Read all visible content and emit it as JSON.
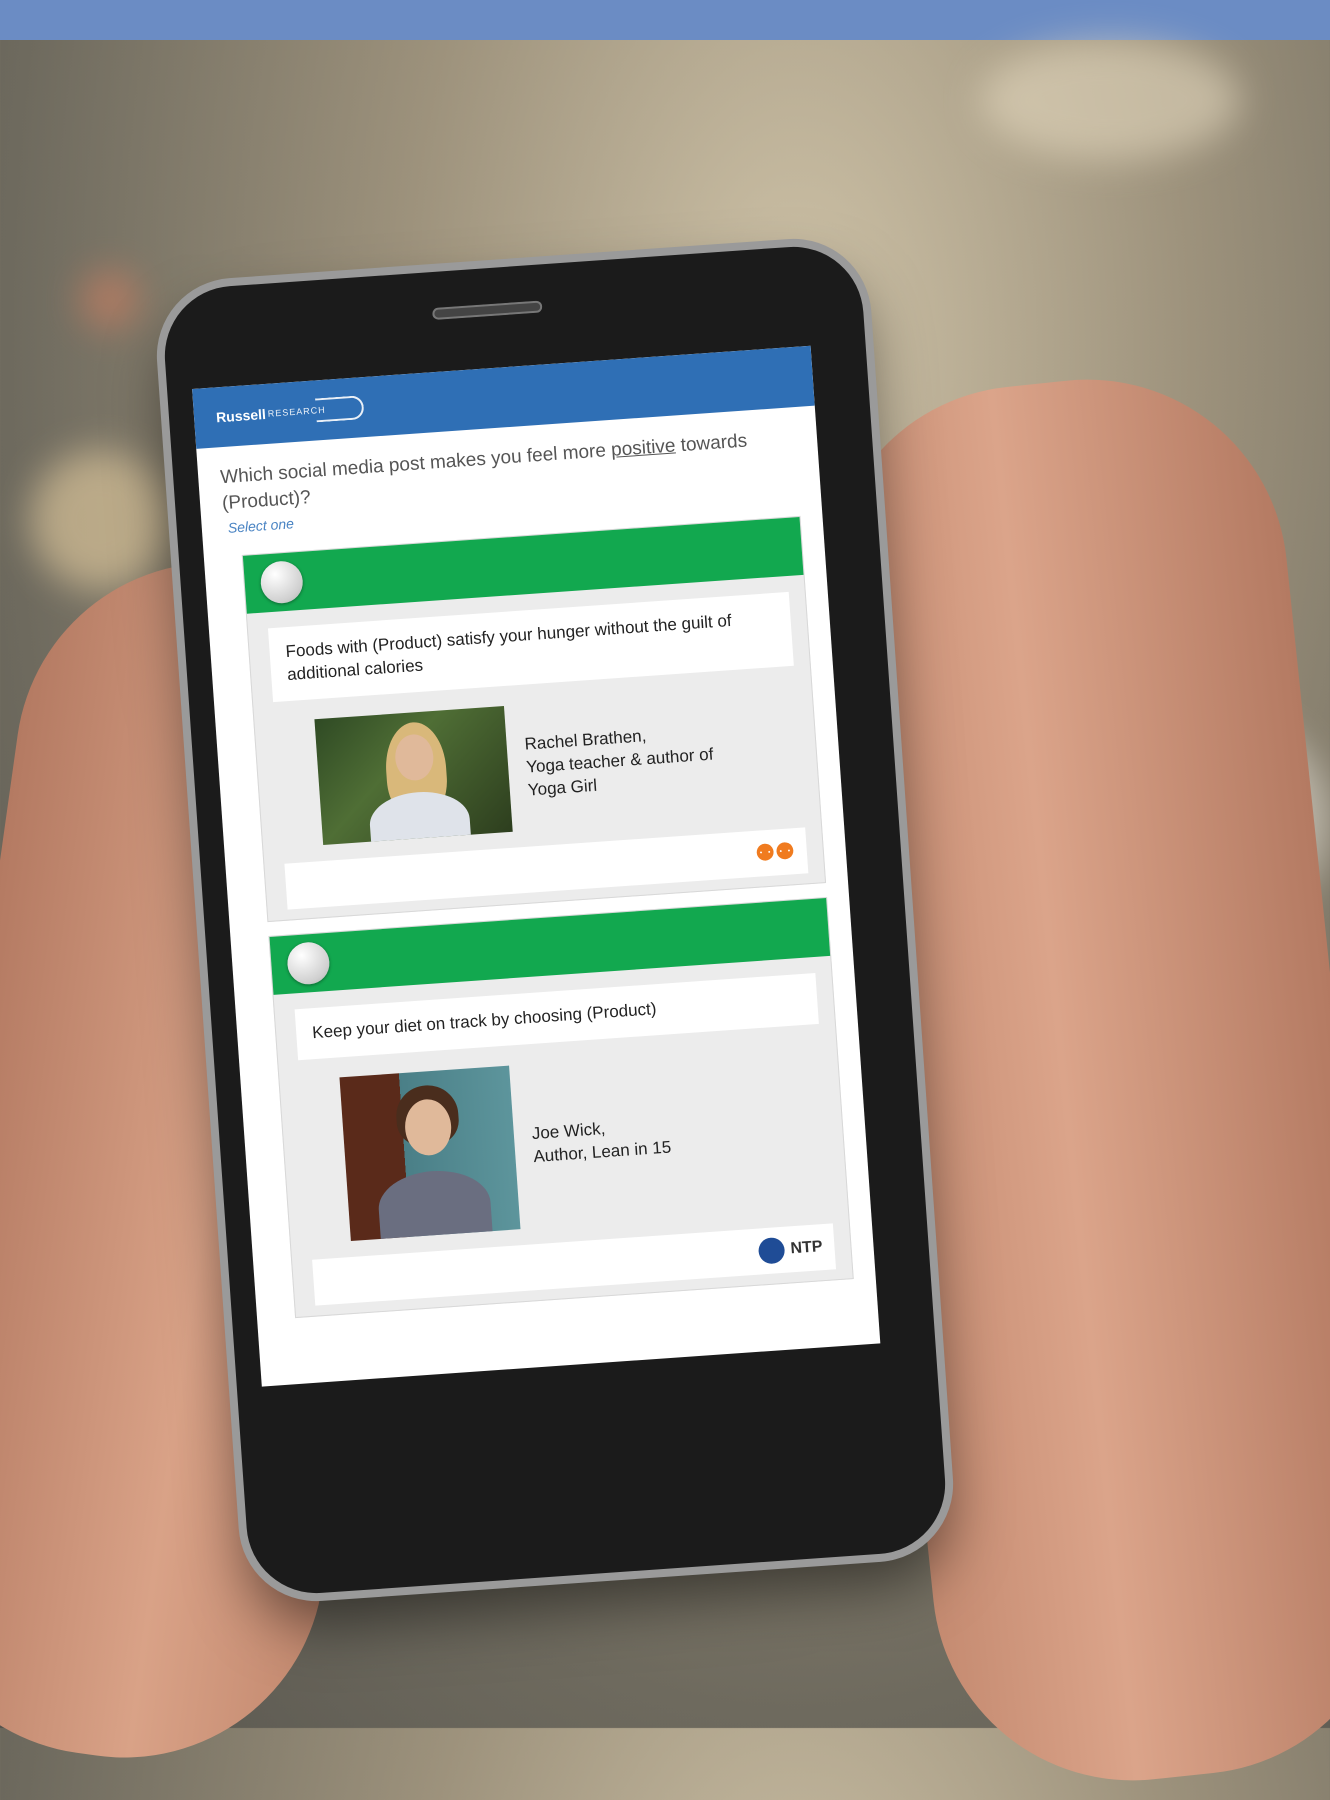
{
  "app": {
    "brand": "Russell",
    "brand_sub": "RESEARCH"
  },
  "survey": {
    "question_pre": "Which social media post makes you feel more ",
    "question_emph": "positive",
    "question_post": " towards (Product)?",
    "hint": "Select one"
  },
  "options": [
    {
      "post_text": "Foods with (Product) satisfy your hunger without the guilt of additional calories",
      "caption_line1": "Rachel Brathen,",
      "caption_line2": "Yoga teacher & author of",
      "caption_line3": "Yoga Girl",
      "sponsor_icon": "people-icon"
    },
    {
      "post_text": "Keep your diet on track by choosing (Product)",
      "caption_line1": "Joe Wick,",
      "caption_line2": "Author, Lean in 15",
      "sponsor": "NTP"
    }
  ],
  "colors": {
    "top_band": "#6b8cc4",
    "app_bar": "#2f6fb5",
    "option_bar": "#12a84f"
  }
}
